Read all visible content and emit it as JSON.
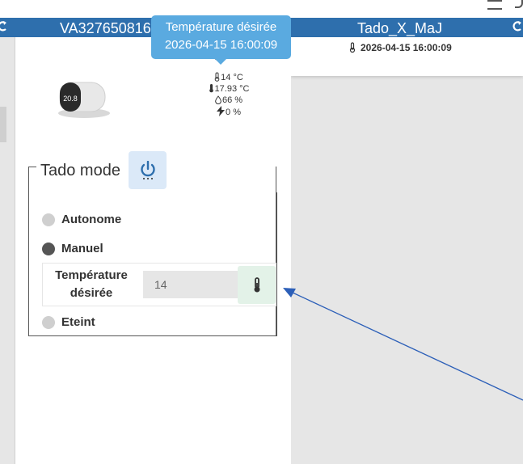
{
  "left_card": {
    "title": "VA327650816",
    "readings": {
      "setpoint": "14 °C",
      "temperature": "17.93 °C",
      "humidity": "66 %",
      "power": "0 %"
    }
  },
  "right_card": {
    "title": "Tado_X_MaJ",
    "date": "2026-04-15 16:00:09"
  },
  "tooltip": {
    "title": "Température désirée",
    "date": "2026-04-15 16:00:09"
  },
  "mode_panel": {
    "legend": "Tado mode",
    "options": {
      "autonome": "Autonome",
      "manuel": "Manuel",
      "eteint": "Eteint"
    },
    "selected": "Manuel",
    "temperature_label": "Température désirée",
    "temperature_value": "14"
  },
  "device_display": {
    "value": "20.8"
  },
  "colors": {
    "header": "#2e6fad",
    "tooltip": "#5aaae0",
    "power_button_bg": "#dbe9f8",
    "thermo_button_bg": "#e3f2e8",
    "arrow": "#2c5fb8"
  }
}
